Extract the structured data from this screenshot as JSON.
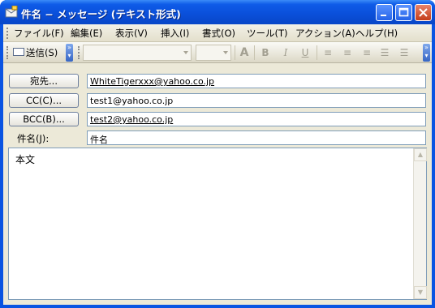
{
  "window": {
    "title": "件名 − メッセージ (テキスト形式)"
  },
  "menu": {
    "items": [
      {
        "label": "ファイル(F)"
      },
      {
        "label": "編集(E)"
      },
      {
        "label": "表示(V)"
      },
      {
        "label": "挿入(I)"
      },
      {
        "label": "書式(O)"
      },
      {
        "label": "ツール(T)"
      },
      {
        "label": "アクション(A)"
      },
      {
        "label": "ヘルプ(H)"
      }
    ]
  },
  "toolbar": {
    "send_label": "送信(S)",
    "font_name": "",
    "font_size": "",
    "format_icons": [
      "font-color-icon",
      "bold-icon",
      "italic-icon",
      "underline-icon",
      "align-left-icon",
      "align-center-icon",
      "align-right-icon",
      "bullets-icon",
      "numbering-icon"
    ],
    "format_glyphs": [
      "A",
      "B",
      "I",
      "U",
      "≡",
      "≡",
      "≡",
      "☰",
      "☰"
    ]
  },
  "fields": {
    "to": {
      "button_label": "宛先...",
      "value": "WhiteTigerxxx@yahoo.co.jp"
    },
    "cc": {
      "button_label": "CC(C)...",
      "value": "test1@yahoo.co.jp"
    },
    "bcc": {
      "button_label": "BCC(B)...",
      "value": "test2@yahoo.co.jp"
    },
    "subject": {
      "label": "件名(J):",
      "value": "件名"
    }
  },
  "body": {
    "text": "本文"
  },
  "colors": {
    "titlebar": "#0a54e2",
    "client_bg": "#ece9d8",
    "input_border": "#7f9db9"
  }
}
